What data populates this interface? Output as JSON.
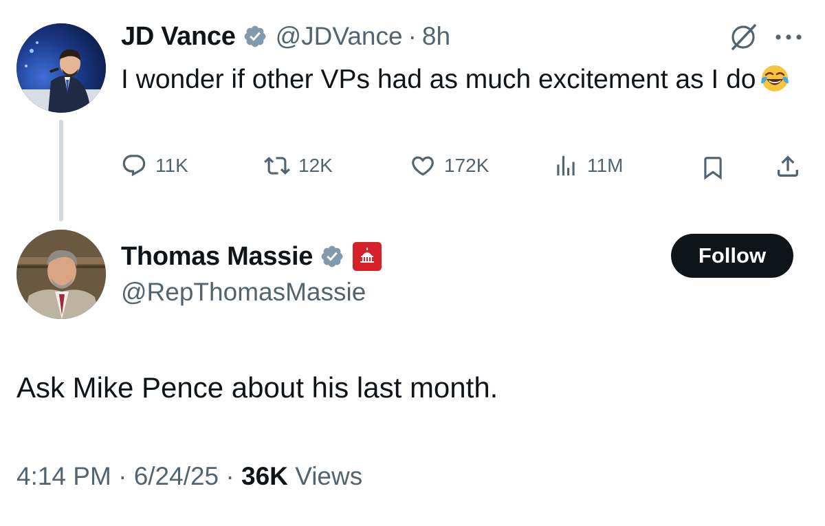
{
  "parent_tweet": {
    "author_name": "JD Vance",
    "handle": "@JDVance",
    "separator": "·",
    "time_ago": "8h",
    "text": "I wonder if other VPs had as much excitement as I do",
    "emoji": "face-with-tears-of-joy",
    "metrics": {
      "replies": "11K",
      "reposts": "12K",
      "likes": "172K",
      "views": "11M"
    }
  },
  "reply_tweet": {
    "author_name": "Thomas Massie",
    "handle": "@RepThomasMassie",
    "follow_label": "Follow",
    "text": "Ask Mike Pence about his last month.",
    "time": "4:14 PM",
    "date": "6/24/25",
    "separator": "·",
    "views_count": "36K",
    "views_label": "Views"
  },
  "colors": {
    "text_primary": "#0f1419",
    "text_secondary": "#536471",
    "verified_blue": "#829aab",
    "follow_bg": "#0f1419",
    "gop_red": "#d6202a",
    "thread_line": "#cfd9de"
  }
}
